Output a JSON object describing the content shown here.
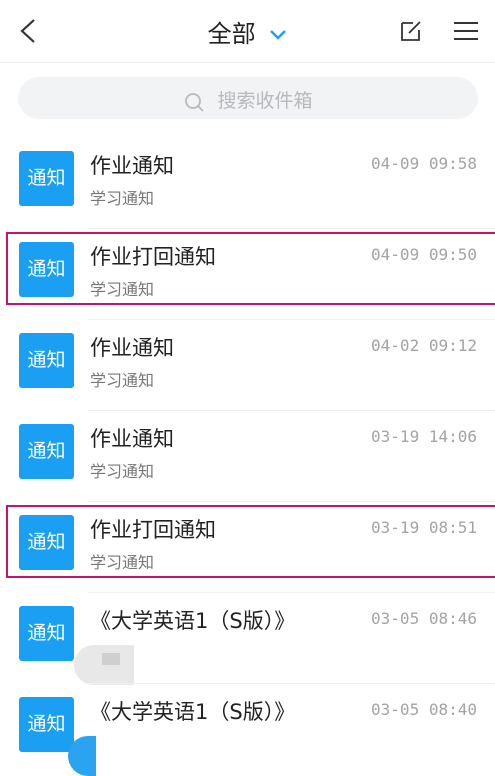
{
  "header": {
    "title": "全部",
    "accent": "#1a9ff2"
  },
  "search": {
    "placeholder": "搜索收件箱"
  },
  "messages": [
    {
      "badge": "通知",
      "title": "作业通知",
      "subtitle": "学习通知",
      "time": "04-09 09:58",
      "highlighted": false
    },
    {
      "badge": "通知",
      "title": "作业打回通知",
      "subtitle": "学习通知",
      "time": "04-09 09:50",
      "highlighted": true
    },
    {
      "badge": "通知",
      "title": "作业通知",
      "subtitle": "学习通知",
      "time": "04-02 09:12",
      "highlighted": false
    },
    {
      "badge": "通知",
      "title": "作业通知",
      "subtitle": "学习通知",
      "time": "03-19 14:06",
      "highlighted": false
    },
    {
      "badge": "通知",
      "title": "作业打回通知",
      "subtitle": "学习通知",
      "time": "03-19 08:51",
      "highlighted": true
    },
    {
      "badge": "通知",
      "title": "《大学英语1（S版）》",
      "subtitle": "",
      "time": "03-05 08:46",
      "highlighted": false
    },
    {
      "badge": "通知",
      "title": "《大学英语1（S版）》",
      "subtitle": "",
      "time": "03-05 08:40",
      "highlighted": false
    }
  ],
  "colors": {
    "highlight_border": "#c0166e",
    "badge_bg": "#1a9ff2"
  }
}
